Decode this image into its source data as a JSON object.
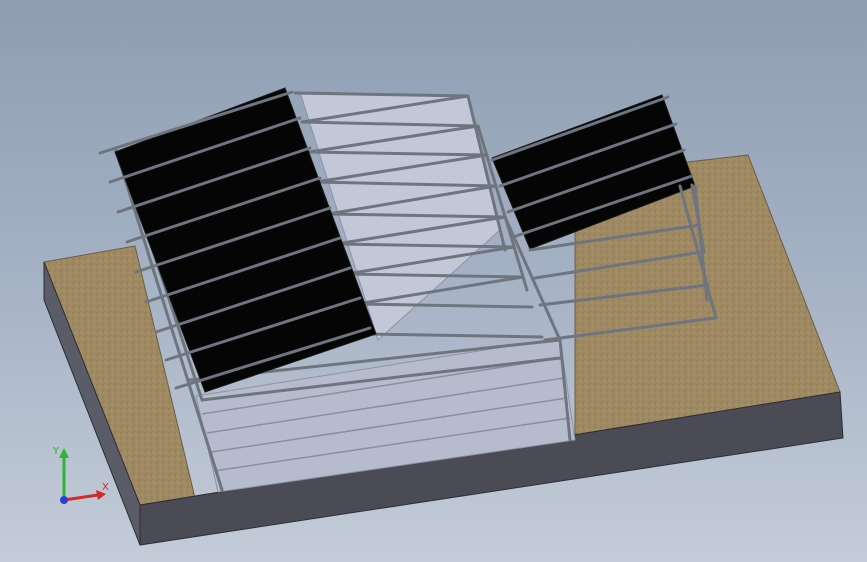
{
  "triad": {
    "x_label": "X",
    "y_label": "Y",
    "x_color": "#d42a2a",
    "y_color": "#2fb52f",
    "z_color": "#2a3fd4"
  },
  "colors": {
    "background_top": "#8e9db2",
    "background_bottom": "#c3ccd8",
    "ground_top": "#a08a63",
    "ground_front": "#4a4b55",
    "ground_side": "#5a5c67",
    "floor_slab": "#b6bccd",
    "steel_tube": "#7a7f88",
    "solar_panel": "#050505"
  }
}
